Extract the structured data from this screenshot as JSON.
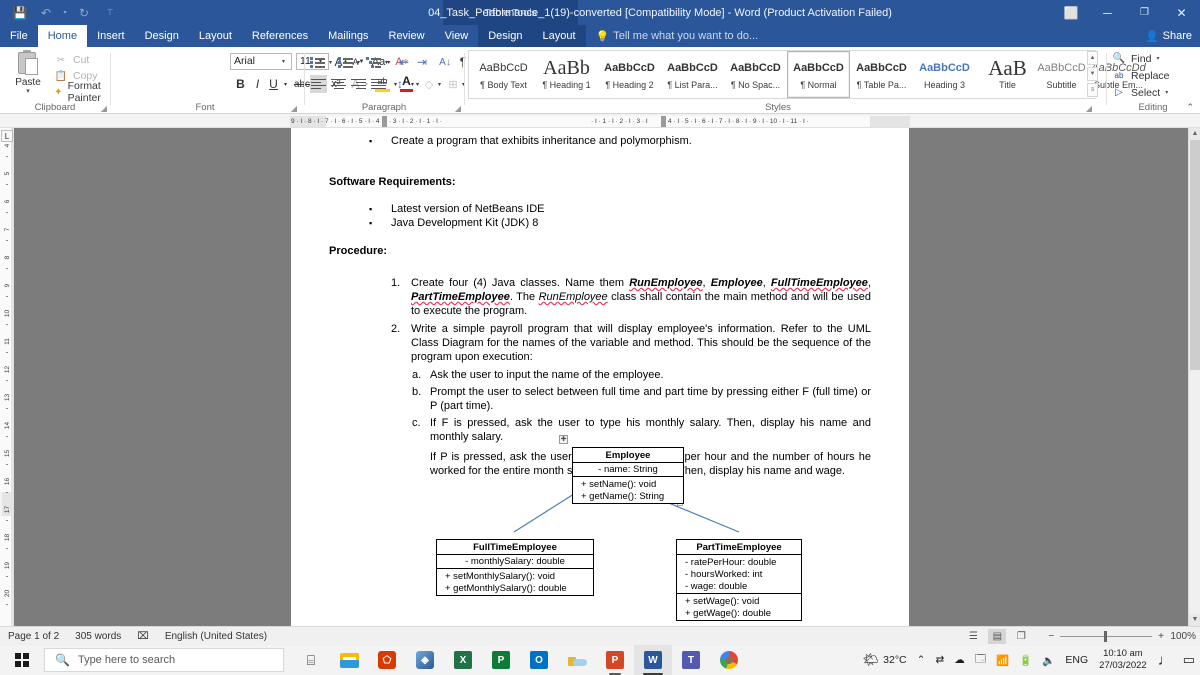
{
  "titlebar": {
    "contextual_tool_label": "Table Tools",
    "document_title": "04_Task_Performance_1(19)-converted [Compatibility Mode] - Word (Product Activation Failed)",
    "quick_access": [
      {
        "name": "save-icon",
        "glyph": "💾"
      },
      {
        "name": "undo-icon",
        "glyph": "↶"
      },
      {
        "name": "undo-dropdown-icon",
        "glyph": "▾"
      },
      {
        "name": "redo-icon",
        "glyph": "↻"
      },
      {
        "name": "customize-qat-icon",
        "glyph": "⊤"
      }
    ],
    "ribbon_display_options": "⬜",
    "minimize": "─",
    "restore": "❐",
    "close": "✕"
  },
  "tabs": [
    {
      "label": "File",
      "state": "file"
    },
    {
      "label": "Home",
      "state": "active"
    },
    {
      "label": "Insert",
      "state": "normal"
    },
    {
      "label": "Design",
      "state": "normal"
    },
    {
      "label": "Layout",
      "state": "normal"
    },
    {
      "label": "References",
      "state": "normal"
    },
    {
      "label": "Mailings",
      "state": "normal"
    },
    {
      "label": "Review",
      "state": "normal"
    },
    {
      "label": "View",
      "state": "normal"
    },
    {
      "label": "Design",
      "state": "contextual"
    },
    {
      "label": "Layout",
      "state": "contextual"
    }
  ],
  "tell_me": "Tell me what you want to do...",
  "share": "Share",
  "ribbon": {
    "groups": [
      {
        "label": "Clipboard"
      },
      {
        "label": "Font"
      },
      {
        "label": "Paragraph"
      },
      {
        "label": "Styles"
      },
      {
        "label": "Editing"
      }
    ],
    "clipboard": {
      "paste": "Paste",
      "cut": "Cut",
      "copy": "Copy",
      "format_painter": "Format Painter"
    },
    "font": {
      "font_name": "Arial",
      "font_size": "11",
      "grow_font": "A",
      "shrink_font": "A",
      "change_case": "Aa",
      "clear_formatting": "A",
      "bold": "B",
      "italic": "I",
      "underline": "U",
      "strikethrough": "abc",
      "subscript": "x₂",
      "superscript": "x²",
      "text_effects": "A",
      "highlight": "ab",
      "font_color": "A"
    },
    "paragraph": {
      "bullets": "•",
      "numbering": "1.",
      "multilevel": "⇲",
      "decrease_indent": "⇤",
      "increase_indent": "⇥",
      "sort": "A↓",
      "show_marks": "¶",
      "align_left": "≡",
      "align_center": "≡",
      "align_right": "≡",
      "justify": "≡",
      "line_spacing": "↕",
      "shading": "◇",
      "borders": "⊞"
    },
    "styles": [
      {
        "preview": "AaBbCcD",
        "name": "¶ Body Text",
        "selected": false,
        "font": "sans"
      },
      {
        "preview": "AaBb",
        "name": "¶ Heading 1",
        "selected": false,
        "font": "serif-big"
      },
      {
        "preview": "AaBbCcD",
        "name": "¶ Heading 2",
        "selected": false,
        "font": "sans-bold"
      },
      {
        "preview": "AaBbCcD",
        "name": "¶ List Para...",
        "selected": false,
        "font": "sans-bold"
      },
      {
        "preview": "AaBbCcD",
        "name": "¶ No Spac...",
        "selected": false,
        "font": "sans-bold"
      },
      {
        "preview": "AaBbCcD",
        "name": "¶ Normal",
        "selected": true,
        "font": "sans-bold"
      },
      {
        "preview": "AaBbCcD",
        "name": "¶ Table Pa...",
        "selected": false,
        "font": "sans-bold"
      },
      {
        "preview": "AaBbCcD",
        "name": "Heading 3",
        "selected": false,
        "font": "sans-blue"
      },
      {
        "preview": "AaB",
        "name": "Title",
        "selected": false,
        "font": "serif-big"
      },
      {
        "preview": "AaBbCcD",
        "name": "Subtitle",
        "selected": false,
        "font": "sans-gray"
      },
      {
        "preview": "AaBbCcDd",
        "name": "Subtle Em...",
        "selected": false,
        "font": "sans-italic"
      }
    ],
    "editing": {
      "find": "Find",
      "replace": "Replace",
      "select": "Select"
    },
    "collapse_ribbon": "⌃"
  },
  "ruler": {
    "horizontal": "9  ·  I  ·  8  ·  I  ·  7  ·  I  ·  6  ·  I  ·  5  ·  I  ·  4  ·  I  ·  3  ·  I  ·  2  ·  I  ·  1  ·  I  ·",
    "horizontal_right": "·  I  ·  1  ·  I  ·  2  ·  I  ·  3  ·  I",
    "horizontal_far": "4  ·  I  ·  5  ·  I  ·  6  ·  I  ·  7  ·  I  ·  8  ·  I  ·  9  ·  I  · 10  ·  I  · 11 ·  I  ·",
    "tab_selector": "L",
    "vertical_numbers": [
      "4",
      "5",
      "6",
      "7",
      "8",
      "9",
      "10",
      "11",
      "12",
      "13",
      "14",
      "15",
      "16",
      "17",
      "18",
      "19",
      "20"
    ]
  },
  "document": {
    "bullet_intro": "Create a program that exhibits inheritance and polymorphism.",
    "software_requirements_heading": "Software Requirements:",
    "software_requirements": [
      "Latest version of NetBeans IDE",
      "Java Development Kit (JDK) 8"
    ],
    "procedure_heading": "Procedure:",
    "step1": {
      "number": "1.",
      "part_a": "Create four (4) Java classes. Name them ",
      "cls1": "RunEmployee",
      "sep1": ", ",
      "cls2": "Employee",
      "sep2": ", ",
      "cls3": "FullTimeEmployee",
      "sep3": ", ",
      "cls4": "PartTimeEmployee",
      "part_b": ". The ",
      "cls5": "RunEmployee",
      "part_c": " class shall contain the main method and will be used to execute the program."
    },
    "step2": {
      "number": "2.",
      "text": "Write a simple payroll program that will display employee's information. Refer to the UML Class Diagram for the names of the variable and method. This should be the sequence of the program upon execution:"
    },
    "substeps": [
      {
        "label": "a.",
        "text": "Ask the user to input the name of the employee."
      },
      {
        "label": "b.",
        "text": "Prompt the user to select between full time and part time by pressing either F (full time) or P (part time)."
      },
      {
        "label": "c.",
        "text": "If F is pressed, ask the user to type his monthly salary. Then, display his name and monthly salary."
      }
    ],
    "substep_extra": "If P is pressed, ask the user to type his rate (pay) per hour and the number of hours he worked for the entire month separated by a space. Then, display his name and wage."
  },
  "uml": {
    "employee": {
      "title": "Employee",
      "attributes": [
        "- name: String"
      ],
      "methods": [
        "+ setName(): void",
        "+ getName(): String"
      ]
    },
    "full_time": {
      "title": "FullTimeEmployee",
      "attributes": [
        "- monthlySalary: double"
      ],
      "methods": [
        "+ setMonthlySalary(): void",
        "+ getMonthlySalary(): double"
      ]
    },
    "part_time": {
      "title": "PartTimeEmployee",
      "attributes": [
        "-   ratePerHour: double",
        "-   hoursWorked: int",
        "-   wage: double"
      ],
      "methods": [
        "+ setWage(): void",
        "+ getWage(): double"
      ]
    },
    "arrow_color": "#4a7ebb"
  },
  "statusbar": {
    "page": "Page 1 of 2",
    "words": "305 words",
    "proofing_icon": "⌧",
    "language": "English (United States)",
    "view_read": "☰",
    "view_print": "▤",
    "view_web": "❐",
    "zoom_out": "−",
    "zoom_in": "+",
    "zoom_level": "100%"
  },
  "taskbar": {
    "search_placeholder": "Type here to search",
    "task_view": "⌸",
    "apps": [
      {
        "name": "file-explorer-icon",
        "label": "",
        "color": "#ffb900"
      },
      {
        "name": "office-icon",
        "label": "",
        "color": "#d83b01"
      },
      {
        "name": "3d-viewer-icon",
        "label": "",
        "color": "#3b5998"
      },
      {
        "name": "excel-icon",
        "label": "X",
        "color": "#217346"
      },
      {
        "name": "publisher-icon",
        "label": "P",
        "color": "#0f7b36"
      },
      {
        "name": "outlook-icon",
        "label": "O",
        "color": "#0072c6"
      },
      {
        "name": "onedrive-icon",
        "label": "",
        "color": "#e8b339"
      },
      {
        "name": "powerpoint-icon",
        "label": "P",
        "color": "#d24726"
      },
      {
        "name": "word-icon",
        "label": "W",
        "color": "#2b579a"
      },
      {
        "name": "teams-icon",
        "label": "T",
        "color": "#5558af"
      },
      {
        "name": "chrome-icon",
        "label": "",
        "color": "#4285f4"
      }
    ],
    "weather_temp": "32°C",
    "tray_expand": "⌃",
    "language_indicator": "ENG",
    "time": "10:10 am",
    "date": "27/03/2022",
    "notification": "▭"
  }
}
